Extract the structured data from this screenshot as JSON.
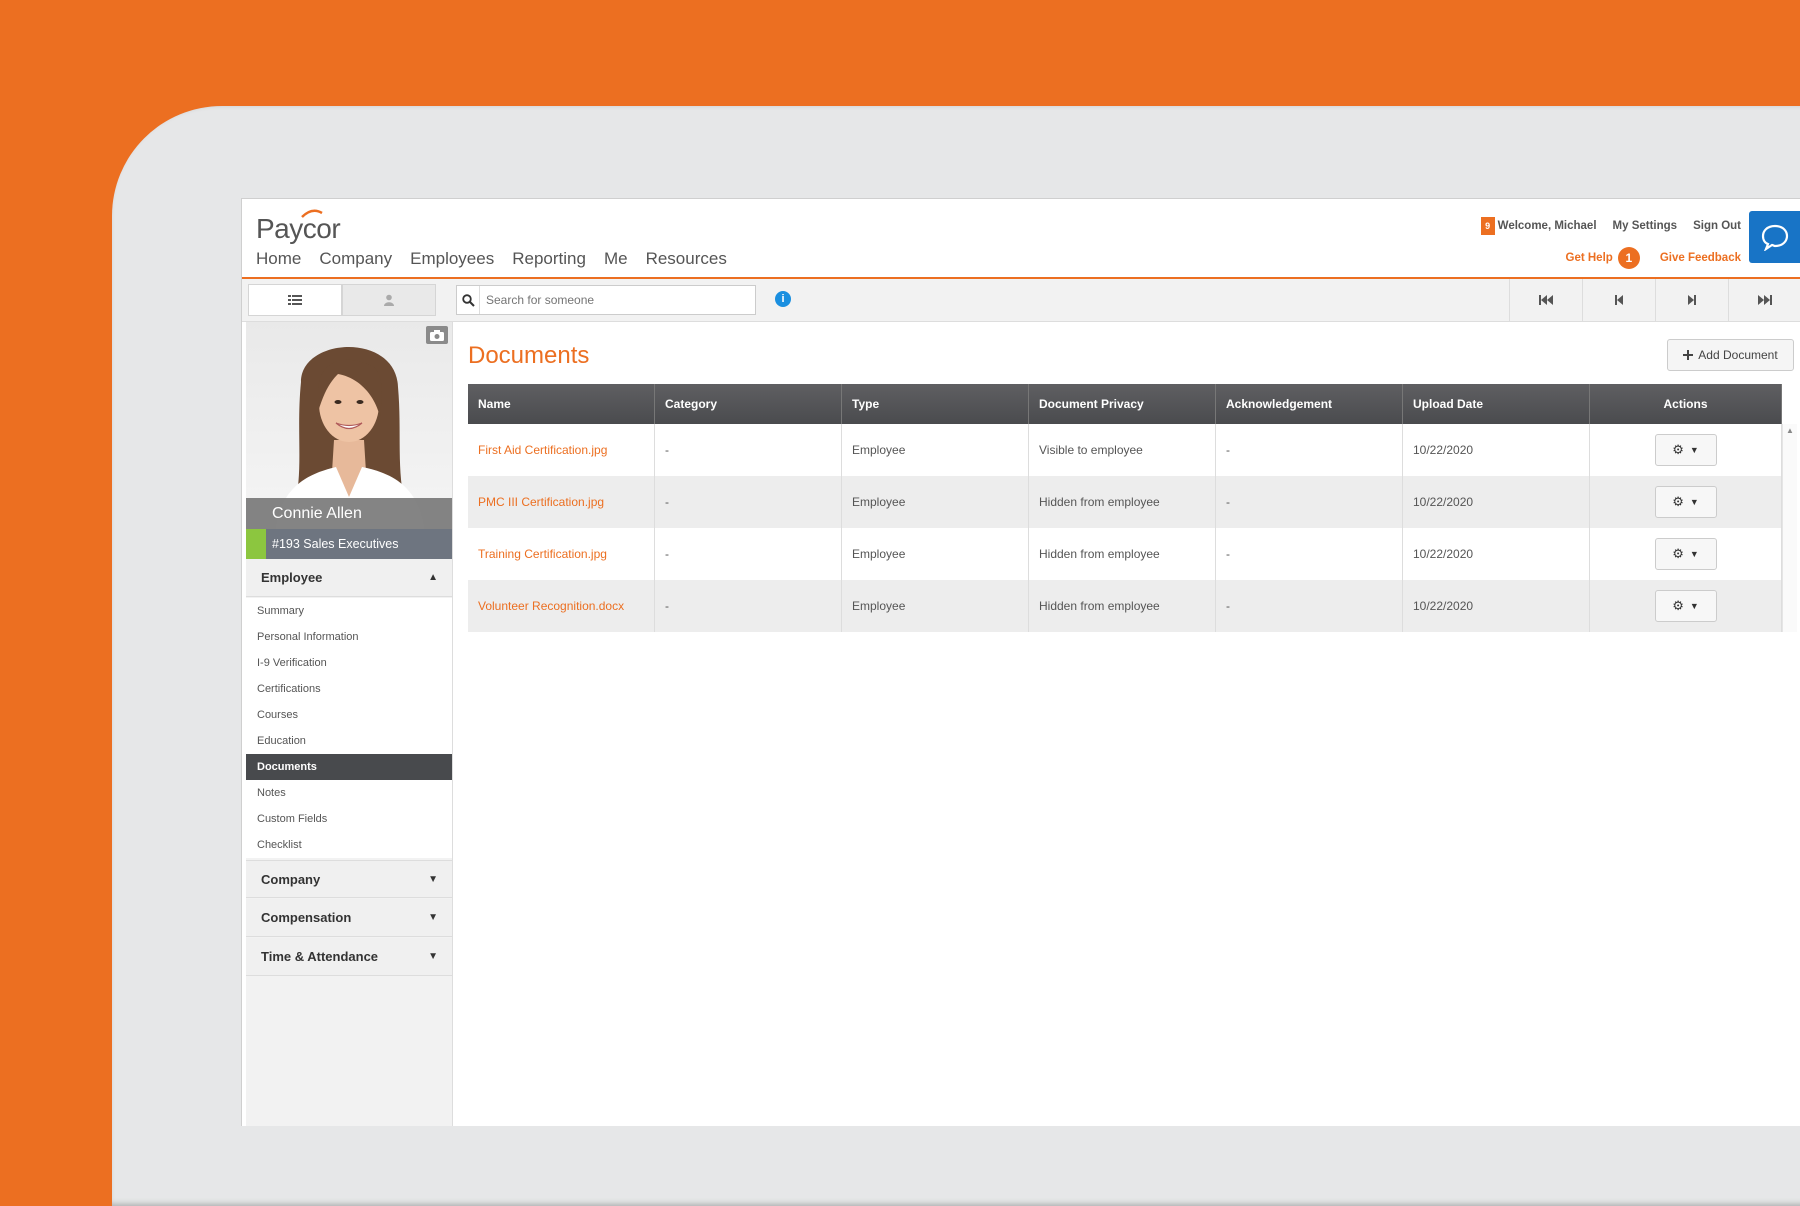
{
  "header": {
    "logo": "Paycor",
    "nav": [
      "Home",
      "Company",
      "Employees",
      "Reporting",
      "Me",
      "Resources"
    ],
    "notif_count": "9",
    "welcome": "Welcome, Michael",
    "my_settings": "My Settings",
    "sign_out": "Sign Out",
    "get_help": "Get Help",
    "help_count": "1",
    "give_feedback": "Give Feedback"
  },
  "toolbar": {
    "search_placeholder": "Search for someone"
  },
  "employee": {
    "name": "Connie Allen",
    "dept": "#193 Sales Executives"
  },
  "sidebar": {
    "employee_section": "Employee",
    "items": [
      "Summary",
      "Personal Information",
      "I-9 Verification",
      "Certifications",
      "Courses",
      "Education",
      "Documents",
      "Notes",
      "Custom Fields",
      "Checklist"
    ],
    "active_item": "Documents",
    "company_section": "Company",
    "compensation_section": "Compensation",
    "time_section": "Time & Attendance"
  },
  "main": {
    "title": "Documents",
    "add_button": "Add Document",
    "columns": [
      "Name",
      "Category",
      "Type",
      "Document Privacy",
      "Acknowledgement",
      "Upload Date",
      "Actions"
    ],
    "rows": [
      {
        "name": "First Aid Certification.jpg",
        "category": "-",
        "type": "Employee",
        "privacy": "Visible to employee",
        "ack": "-",
        "date": "10/22/2020"
      },
      {
        "name": "PMC III Certification.jpg",
        "category": "-",
        "type": "Employee",
        "privacy": "Hidden from employee",
        "ack": "-",
        "date": "10/22/2020"
      },
      {
        "name": "Training Certification.jpg",
        "category": "-",
        "type": "Employee",
        "privacy": "Hidden from employee",
        "ack": "-",
        "date": "10/22/2020"
      },
      {
        "name": "Volunteer Recognition.docx",
        "category": "-",
        "type": "Employee",
        "privacy": "Hidden from employee",
        "ack": "-",
        "date": "10/22/2020"
      }
    ]
  },
  "colors": {
    "brand_orange": "#ec6f21",
    "chat_blue": "#1874c6",
    "dept_green": "#8cc63f"
  }
}
